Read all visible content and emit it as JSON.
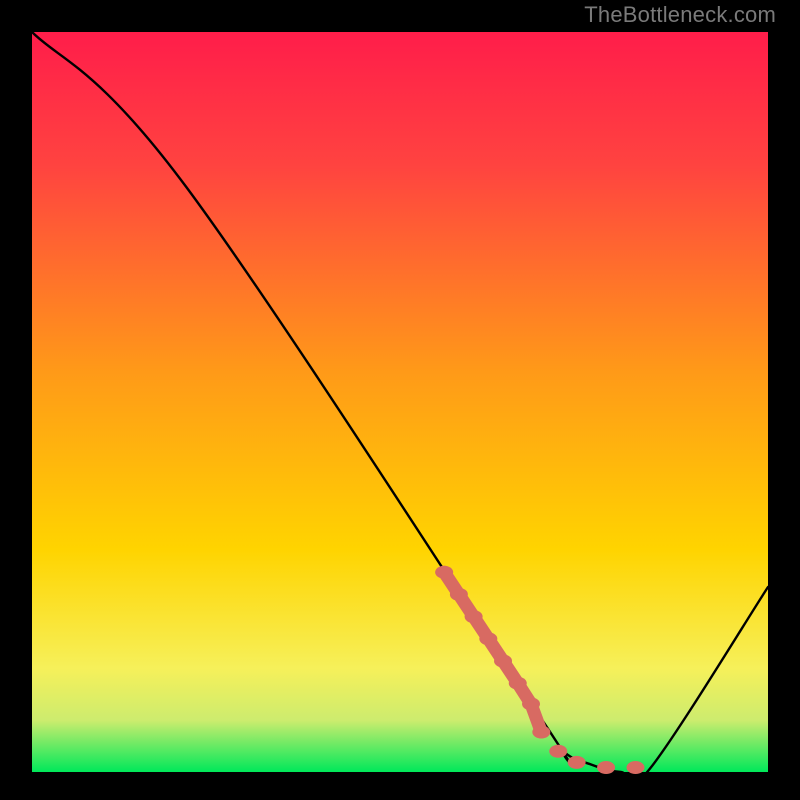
{
  "watermark": "TheBottleneck.com",
  "chart_data": {
    "type": "line",
    "title": "",
    "xlabel": "",
    "ylabel": "",
    "xlim": [
      0,
      100
    ],
    "ylim": [
      0,
      100
    ],
    "grid": false,
    "legend": false,
    "background_gradient": {
      "top_color": "#ff1d4a",
      "mid_color": "#ffd400",
      "bottom_color": "#00e85a"
    },
    "series": [
      {
        "name": "bottleneck-curve",
        "color": "#000000",
        "x": [
          0,
          21,
          68,
          72,
          76,
          80,
          84,
          100
        ],
        "y": [
          100,
          79,
          9,
          3,
          1,
          0,
          0.5,
          25
        ]
      }
    ],
    "markers": {
      "name": "highlight-segment",
      "color": "#d86a62",
      "x": [
        56,
        58,
        60,
        62,
        64,
        66,
        67.8,
        69.2,
        71.5,
        74,
        78,
        82
      ],
      "y": [
        27,
        24,
        21,
        18,
        15,
        12,
        9.2,
        5.4,
        2.8,
        1.3,
        0.6,
        0.6
      ]
    }
  }
}
